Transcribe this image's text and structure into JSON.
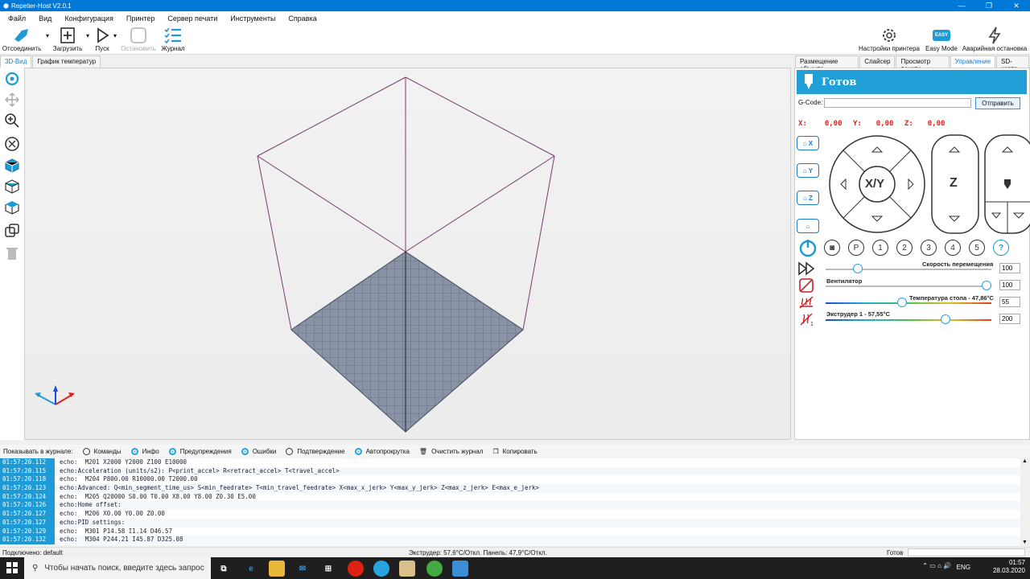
{
  "window": {
    "title": "Repetier-Host V2.0.1"
  },
  "menu": [
    "Файл",
    "Вид",
    "Конфигурация",
    "Принтер",
    "Сервер печати",
    "Инструменты",
    "Справка"
  ],
  "toolbar": {
    "disconnect": "Отсоединить",
    "load": "Загрузить",
    "run": "Пуск",
    "stop": "Остановить",
    "log": "Журнал",
    "printer_settings": "Настройки принтера",
    "easy_mode": "Easy Mode",
    "easy_badge": "EASY",
    "emergency_stop": "Аварийная остановка"
  },
  "left_tabs": [
    "3D-Вид",
    "График температур"
  ],
  "right_tabs": [
    "Размещение объекта",
    "Слайсер",
    "Просмотр печати",
    "Управление",
    "SD-карта"
  ],
  "control": {
    "status": "Готов",
    "gcode_label": "G-Code:",
    "send": "Отправить",
    "x_label": "X:",
    "x_value": "0,00",
    "y_label": "Y:",
    "y_value": "0,00",
    "z_label": "Z:",
    "z_value": "0,00",
    "home_x": "X",
    "home_y": "Y",
    "home_z": "Z",
    "xy_label": "X/Y",
    "z_axis_label": "Z",
    "circle_buttons": [
      "P",
      "1",
      "2",
      "3",
      "4",
      "5",
      "?"
    ],
    "speed_label": "Скорость перемещения",
    "speed_value": "100",
    "speed_level": 0.2,
    "fan_label": "Вентилятор",
    "fan_value": "100",
    "fan_level": 1.0,
    "bed_label": "Температура стола - 47,86°C",
    "bed_value": "55",
    "extruder_label": "Экструдер 1 - 57,55°C",
    "extruder_value": "200"
  },
  "logbar": {
    "show_label": "Показывать в журнале:",
    "commands": "Команды",
    "info": "Инфо",
    "warnings": "Предупреждения",
    "errors": "Ошибки",
    "ack": "Подтверждение",
    "autoscroll": "Автопрокрутка",
    "clear": "Очистить журнал",
    "copy": "Копировать"
  },
  "log": [
    {
      "t": "01:57:20.112",
      "m": "echo:  M201 X2000 Y2000 Z100 E10000"
    },
    {
      "t": "01:57:20.115",
      "m": "echo:Acceleration (units/s2): P<print_accel> R<retract_accel> T<travel_accel>"
    },
    {
      "t": "01:57:20.118",
      "m": "echo:  M204 P800.00 R10000.00 T2000.00"
    },
    {
      "t": "01:57:20.123",
      "m": "echo:Advanced: Q<min_segment_time_us> S<min_feedrate> T<min_travel_feedrate> X<max_x_jerk> Y<max_y_jerk> Z<max_z_jerk> E<max_e_jerk>"
    },
    {
      "t": "01:57:20.124",
      "m": "echo:  M205 Q20000 S0.00 T0.00 X8.00 Y8.00 Z0.30 E5.00"
    },
    {
      "t": "01:57:20.126",
      "m": "echo:Home offset:"
    },
    {
      "t": "01:57:20.127",
      "m": "echo:  M206 X0.00 Y0.00 Z0.00"
    },
    {
      "t": "01:57:20.127",
      "m": "echo:PID settings:"
    },
    {
      "t": "01:57:20.129",
      "m": "echo:  M301 P14.58 I1.14 D46.57"
    },
    {
      "t": "01:57:20.132",
      "m": "echo:  M304 P244.21 I45.87 D325.08"
    }
  ],
  "status": {
    "connection": "Подключено: default",
    "temps": "Экструдер: 57,6°C/Откл. Панель: 47,9°C/Откл.",
    "state": "Готов"
  },
  "taskbar": {
    "search_placeholder": "Чтобы начать поиск, введите здесь запрос",
    "lang": "ENG",
    "time": "01:57",
    "date": "28.03.2020"
  }
}
